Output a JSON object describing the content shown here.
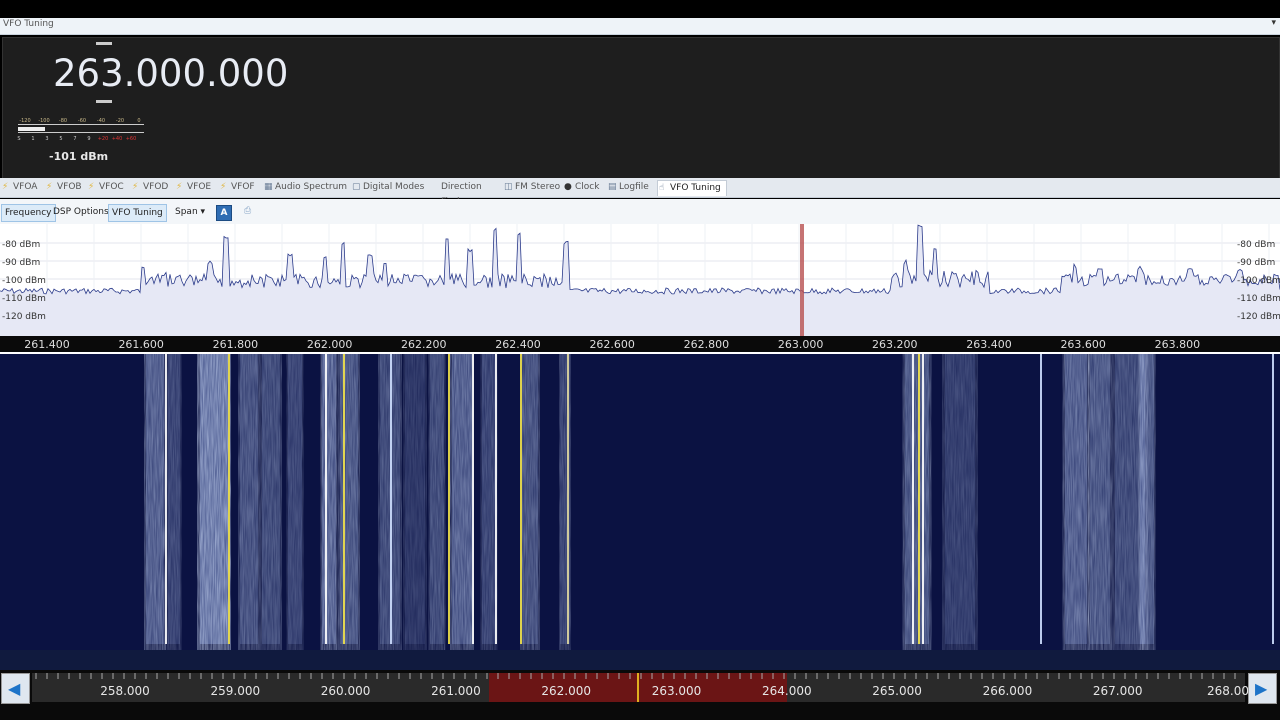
{
  "window": {
    "title": "VFO Tuning",
    "collapse_icon": "chevron-down-icon"
  },
  "vfo": {
    "frequency": "263.000.000",
    "signal_level": "-101 dBm",
    "smeter_scale": [
      "-120",
      "-100",
      "-80",
      "-60",
      "-40",
      "-20",
      "0"
    ],
    "smeter_units": [
      "S",
      "1",
      "3",
      "5",
      "7",
      "9",
      "+20",
      "+40",
      "+60"
    ]
  },
  "tabs": [
    {
      "label": "VFOA",
      "icon": "lightning-icon"
    },
    {
      "label": "VFOB",
      "icon": "lightning-icon"
    },
    {
      "label": "VFOC",
      "icon": "lightning-icon"
    },
    {
      "label": "VFOD",
      "icon": "lightning-icon"
    },
    {
      "label": "VFOE",
      "icon": "lightning-icon"
    },
    {
      "label": "VFOF",
      "icon": "lightning-icon"
    },
    {
      "label": "Audio Spectrum",
      "icon": "spectrum-icon"
    },
    {
      "label": "Digital Modes",
      "icon": "doc-icon"
    },
    {
      "label": "Direction Finder",
      "icon": ""
    },
    {
      "label": "FM Stereo",
      "icon": "stereo-icon"
    },
    {
      "label": "Clock",
      "icon": "clock-icon"
    },
    {
      "label": "Logfile",
      "icon": "log-icon"
    },
    {
      "label": "VFO Tuning",
      "icon": "hand-icon"
    }
  ],
  "toolbar": {
    "frequency": "Frequency",
    "dsp": "DSP Options",
    "vfo_tuning": "VFO Tuning",
    "span": "Span",
    "auto": "A"
  },
  "spectrum": {
    "db_labels": [
      "-80 dBm",
      "-90 dBm",
      "-100 dBm",
      "-110 dBm",
      "-120 dBm"
    ],
    "freq_labels": [
      "261.400",
      "261.600",
      "261.800",
      "262.000",
      "262.200",
      "262.400",
      "262.600",
      "262.800",
      "263.000",
      "263.200",
      "263.400",
      "263.600",
      "263.800"
    ]
  },
  "bottom_scale": {
    "labels": [
      "258.000",
      "259.000",
      "260.000",
      "261.000",
      "262.000",
      "263.000",
      "264.000",
      "265.000",
      "266.000",
      "267.000",
      "268.00"
    ]
  },
  "colors": {
    "accent": "#2f6db3",
    "marker": "#8b1a1a",
    "waterfall_bg": "#0a1040"
  }
}
